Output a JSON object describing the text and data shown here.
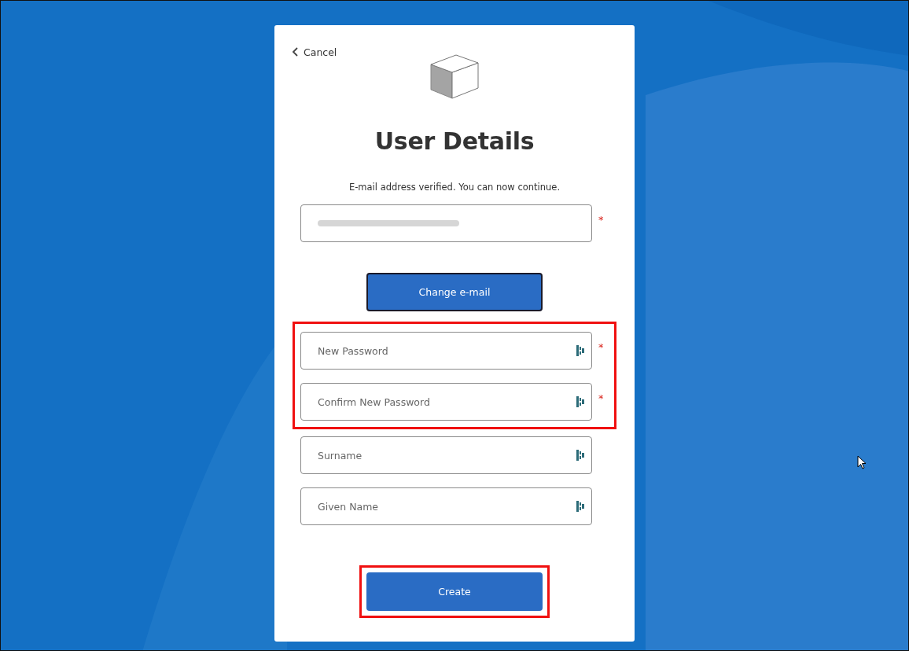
{
  "cancel": {
    "label": "Cancel"
  },
  "title": "User Details",
  "message": "E-mail address verified. You can now continue.",
  "email_field": {
    "marker": "*"
  },
  "change_email_button": "Change e-mail",
  "field_groups": [
    {
      "highlighted": true,
      "fields": [
        {
          "placeholder": "New Password",
          "marker": "*"
        },
        {
          "placeholder": "Confirm New Password",
          "marker": "*"
        }
      ]
    },
    {
      "highlighted": false,
      "fields": [
        {
          "placeholder": "Surname"
        },
        {
          "placeholder": "Given Name"
        }
      ]
    }
  ],
  "create_button": {
    "label": "Create",
    "highlighted": true
  }
}
